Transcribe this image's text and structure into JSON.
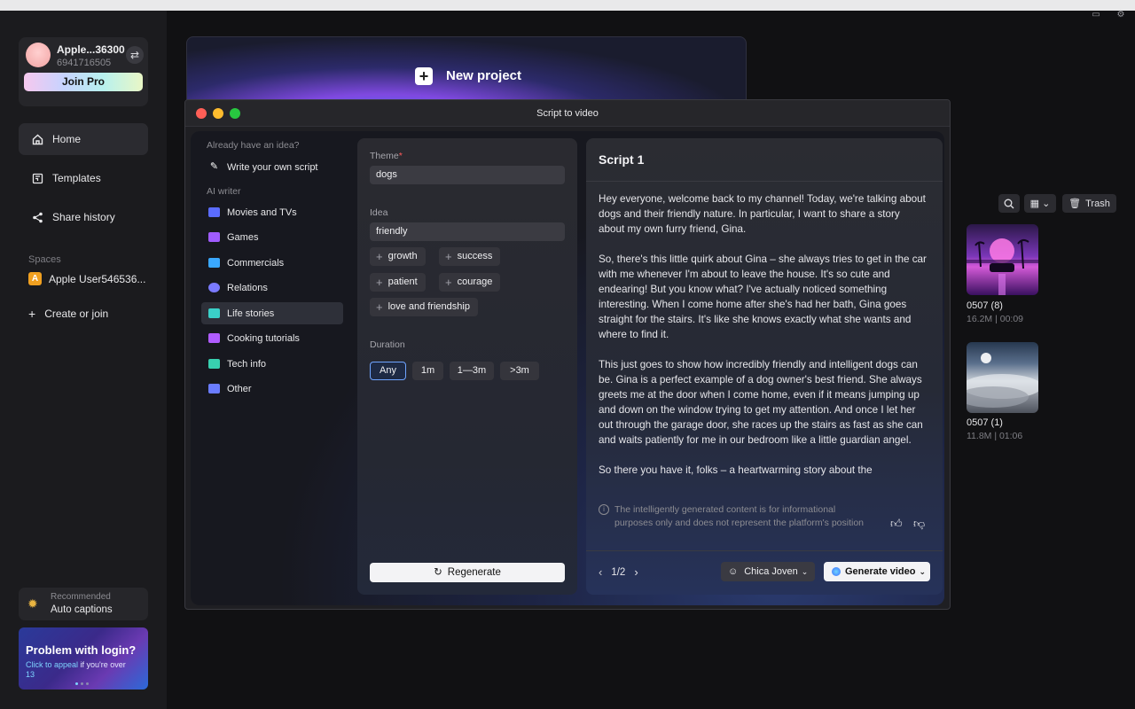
{
  "account": {
    "name": "Apple...36300",
    "id": "6941716505",
    "join_label": "Join Pro"
  },
  "nav": [
    {
      "label": "Home"
    },
    {
      "label": "Templates"
    },
    {
      "label": "Share history"
    }
  ],
  "spaces": {
    "label": "Spaces",
    "space_badge": "A",
    "space_name": "Apple User546536...",
    "create_label": "Create or join"
  },
  "recommended": {
    "label": "Recommended",
    "item": "Auto captions"
  },
  "promo": {
    "title": "Problem with login?",
    "line1": "Click to appeal",
    "line2": " if you're over",
    "line3": "13"
  },
  "new_project": {
    "label": "New project"
  },
  "toolbar": {
    "trash_label": "Trash"
  },
  "media": [
    {
      "title": "0507 (8)",
      "meta": "16.2M | 00:09"
    },
    {
      "title": "0507 (1)",
      "meta": "11.8M | 01:06"
    }
  ],
  "modal": {
    "title": "Script to video",
    "left": {
      "heading1": "Already have an idea?",
      "own_script": "Write your own script",
      "heading2": "AI writer",
      "items": [
        {
          "label": "Movies and TVs",
          "color": "#5b6cff"
        },
        {
          "label": "Games",
          "color": "#a05cff"
        },
        {
          "label": "Commercials",
          "color": "#3aa8ff"
        },
        {
          "label": "Relations",
          "color": "#7a7aff"
        },
        {
          "label": "Life stories",
          "color": "#3ad0c8"
        },
        {
          "label": "Cooking tutorials",
          "color": "#b05cff"
        },
        {
          "label": "Tech info",
          "color": "#38d0b0"
        },
        {
          "label": "Other",
          "color": "#6a7cff"
        }
      ]
    },
    "form": {
      "theme_label": "Theme",
      "theme_required": "*",
      "theme_value": "dogs",
      "idea_label": "Idea",
      "idea_value": "friendly",
      "tags": [
        "growth",
        "success",
        "patient",
        "courage",
        "love and friendship"
      ],
      "duration_label": "Duration",
      "durations": [
        "Any",
        "1m",
        "1—3m",
        ">3m"
      ],
      "selected_duration": "Any",
      "regenerate_label": "Regenerate"
    },
    "script": {
      "title": "Script 1",
      "paragraphs": [
        "Hey everyone, welcome back to my channel! Today, we're talking about dogs and their friendly nature. In particular, I want to share a story about my own furry friend, Gina.",
        "So, there's this little quirk about Gina – she always tries to get in the car with me whenever I'm about to leave the house. It's so cute and endearing! But you know what? I've actually noticed something interesting. When I come home after she's had her bath, Gina goes straight for the stairs. It's like she knows exactly what she wants and where to find it.",
        "This just goes to show how incredibly friendly and intelligent dogs can be. Gina is a perfect example of a dog owner's best friend. She always greets me at the door when I come home, even if it means jumping up and down on the window trying to get my attention. And once I let her out through the garage door, she races up the stairs as fast as she can and waits patiently for me in our bedroom like a little guardian angel.",
        "So there you have it, folks – a heartwarming story about the"
      ],
      "disclaimer": "The intelligently generated content is for informational purposes only and does not represent the platform's position",
      "page": "1/2",
      "voice": "Chica Joven",
      "generate_label": "Generate video"
    }
  }
}
